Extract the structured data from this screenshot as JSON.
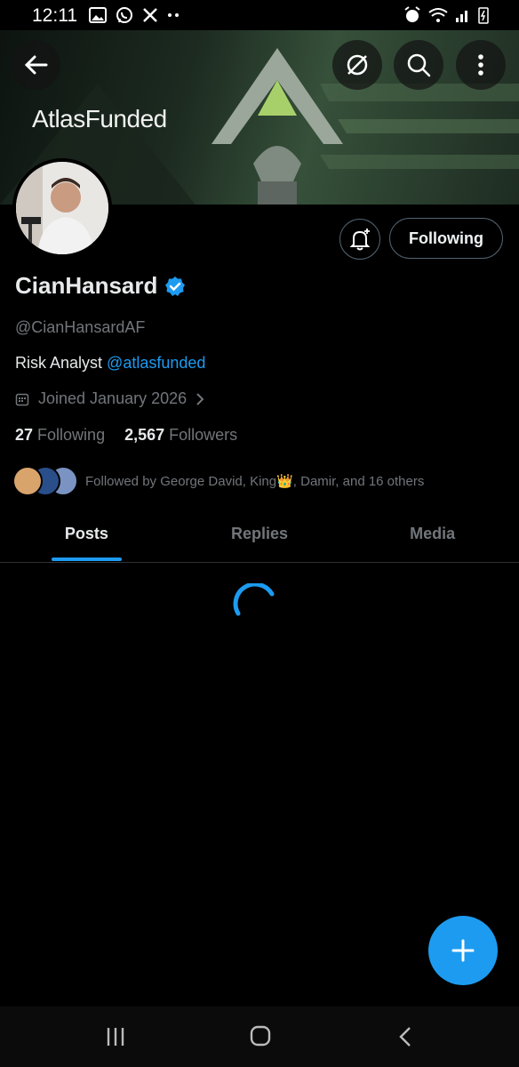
{
  "status_bar": {
    "time": "12:11",
    "left_icons": [
      "gallery-icon",
      "whatsapp-icon",
      "x-logo-icon",
      "more-dots-icon"
    ],
    "right_icons": [
      "alarm-icon",
      "wifi-icon",
      "signal-icon",
      "battery-charging-icon"
    ]
  },
  "header": {
    "banner_logo": "AtlasFunded",
    "back_icon": "back-arrow-icon",
    "grok_icon": "grok-icon",
    "search_icon": "search-icon",
    "more_icon": "more-vertical-icon"
  },
  "profile": {
    "display_name": "CianHansard",
    "verified": true,
    "handle": "@CianHansardAF",
    "bio_text": "Risk Analyst ",
    "bio_link": "@atlasfunded",
    "joined": "Joined January 2026",
    "following_count": "27",
    "following_label": "Following",
    "followers_count": "2,567",
    "followers_label": "Followers",
    "follow_button": "Following",
    "followed_by": "Followed by George David, King👑, Damir, and 16 others"
  },
  "tabs": [
    {
      "label": "Posts",
      "active": true
    },
    {
      "label": "Replies",
      "active": false
    },
    {
      "label": "Media",
      "active": false
    }
  ],
  "colors": {
    "accent": "#1d9bf0",
    "background": "#000000",
    "secondary_text": "#71767b"
  }
}
